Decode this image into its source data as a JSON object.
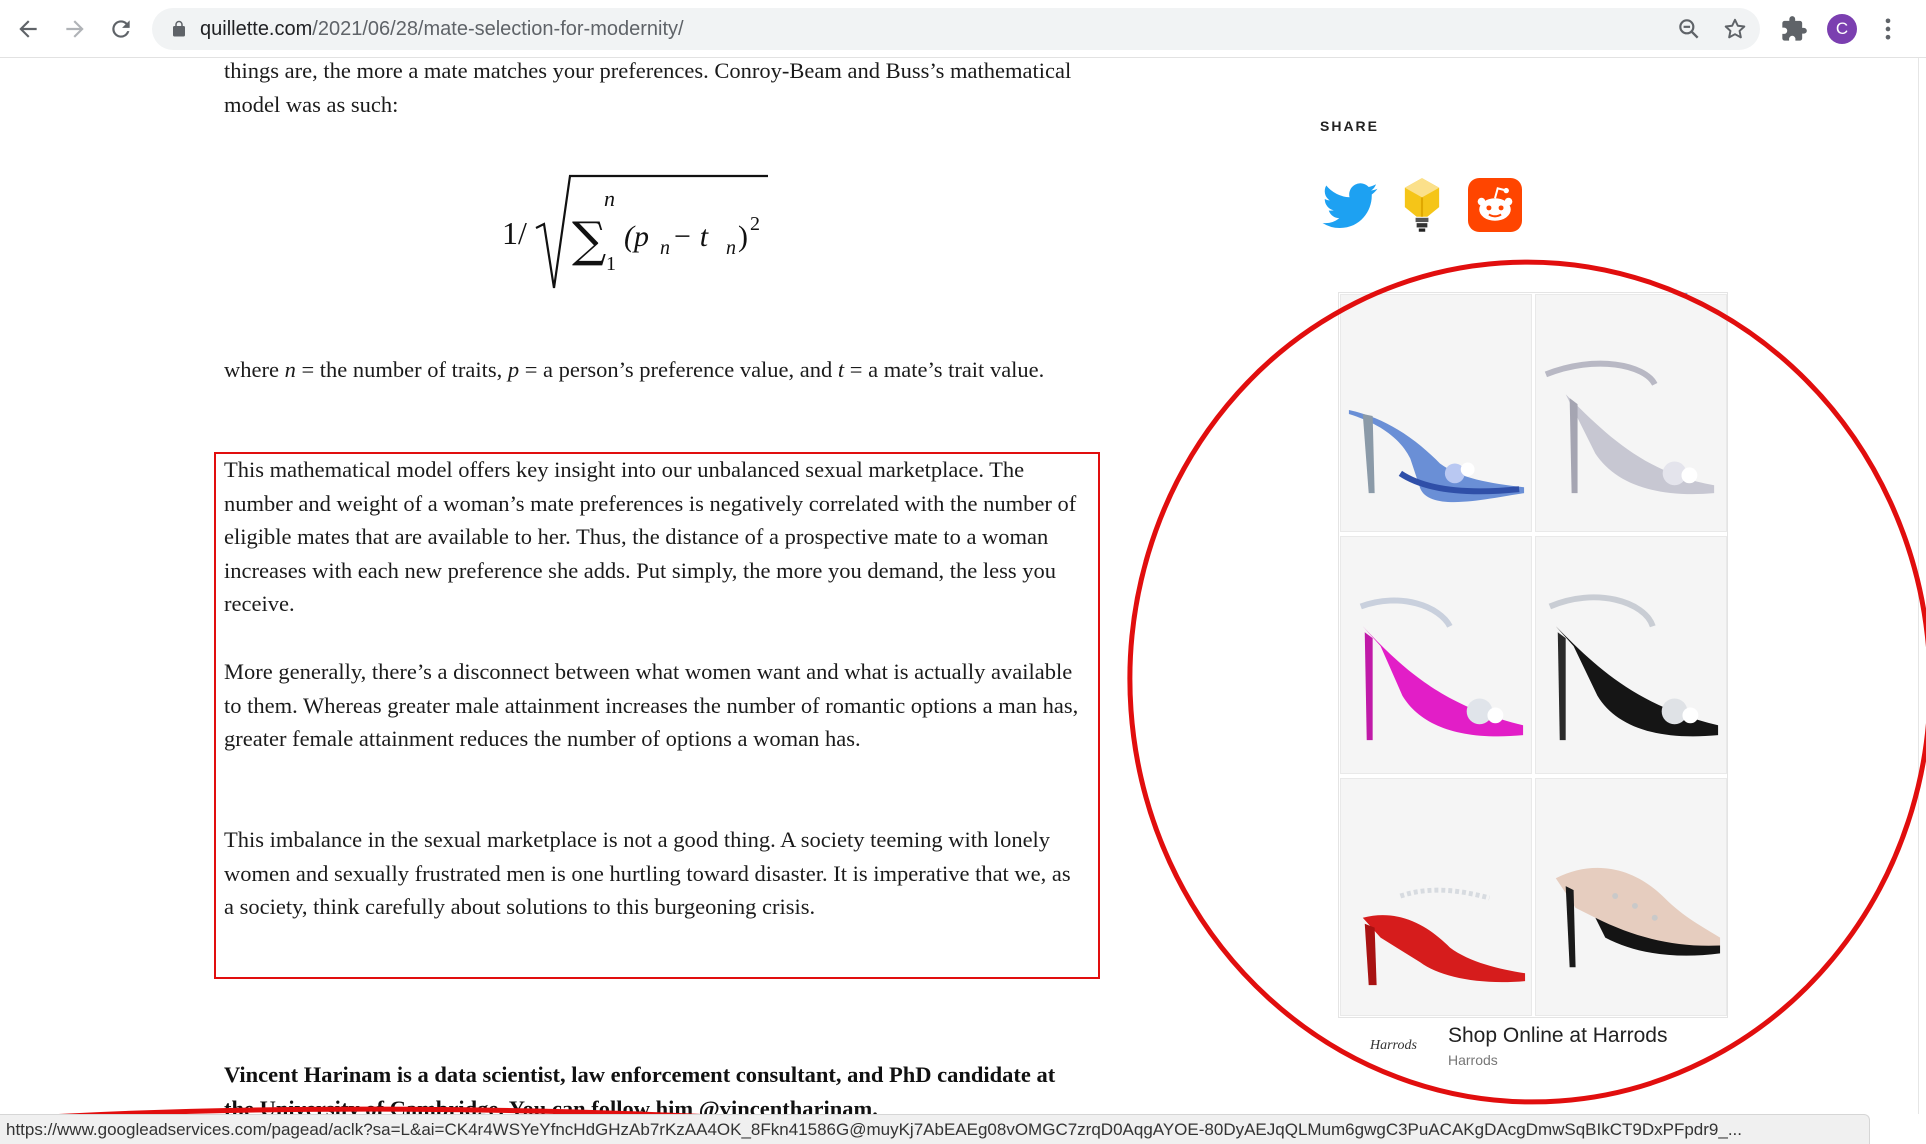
{
  "browser": {
    "url_host": "quillette.com",
    "url_path": "/2021/06/28/mate-selection-for-modernity/",
    "profile_initial": "C",
    "status_url": "https://www.googleadservices.com/pagead/aclk?sa=L&ai=CK4r4WSYeYfncHdGHzAb7rKzAA4OK_8Fkn41586G@muyKj7AbEAEg08vOMGC7zrqD0AqgAYOE-80DyAEJqQLMum6gwgC3PuACAKgDAcgDmwSqBIkCT9DxPFpdr9_..."
  },
  "article": {
    "intro": "things are, the more a mate matches your preferences. Conroy-Beam and Buss’s mathematical model was as such:",
    "formula": {
      "lead": "1/",
      "sigma": "∑",
      "upper": "n",
      "lower": "1",
      "body": "(p",
      "sub1": "n",
      "minus": " − t",
      "sub2": "n",
      "close": ")",
      "exp": "2"
    },
    "where_prefix": "where ",
    "where_n": "n",
    "where_mid1": " = the number of traits, ",
    "where_p": "p",
    "where_mid2": " = a person’s preference value, and ",
    "where_t": "t",
    "where_end": " = a mate’s trait value.",
    "para_a": "This mathematical model offers key insight into our unbalanced sexual marketplace. The number and weight of a woman’s mate preferences is negatively correlated with the number of eligible mates that are available to her. Thus, the distance of a prospective mate to a woman increases with each new preference she adds. Put simply, the more you demand, the less you receive.",
    "para_b": "More generally, there’s a disconnect between what women want and what is actually available to them. Whereas greater male attainment increases the number of romantic options a man has, greater female attainment reduces the number of options a woman has.",
    "para_c": "This imbalance in the sexual marketplace is not a good thing. A society teeming with lonely women and sexually frustrated men is one hurtling toward disaster. It is imperative that we, as a society, think carefully about solutions to this burgeoning crisis.",
    "bio": "Vincent Harinam is a data scientist, law enforcement consultant, and PhD candidate at the University of Cambridge. You can follow him @vincentharinam."
  },
  "share": {
    "label": "SHARE",
    "icons": [
      "twitter-icon",
      "idea-bulb-icon",
      "reddit-icon"
    ]
  },
  "ad": {
    "close_glyph": "✕",
    "advertiser_logo": "Harrods",
    "title": "Shop Online at Harrods",
    "subtitle": "Harrods",
    "products": [
      "blue-jeweled-mule",
      "silver-glitter-heel",
      "pink-satin-bow-heel",
      "black-satin-bow-heel",
      "red-patent-pump",
      "studded-slingback"
    ]
  },
  "colors": {
    "annotation": "#e10e0e",
    "twitter": "#1da1f2",
    "reddit": "#ff4500",
    "bulb": "#f5c518"
  }
}
